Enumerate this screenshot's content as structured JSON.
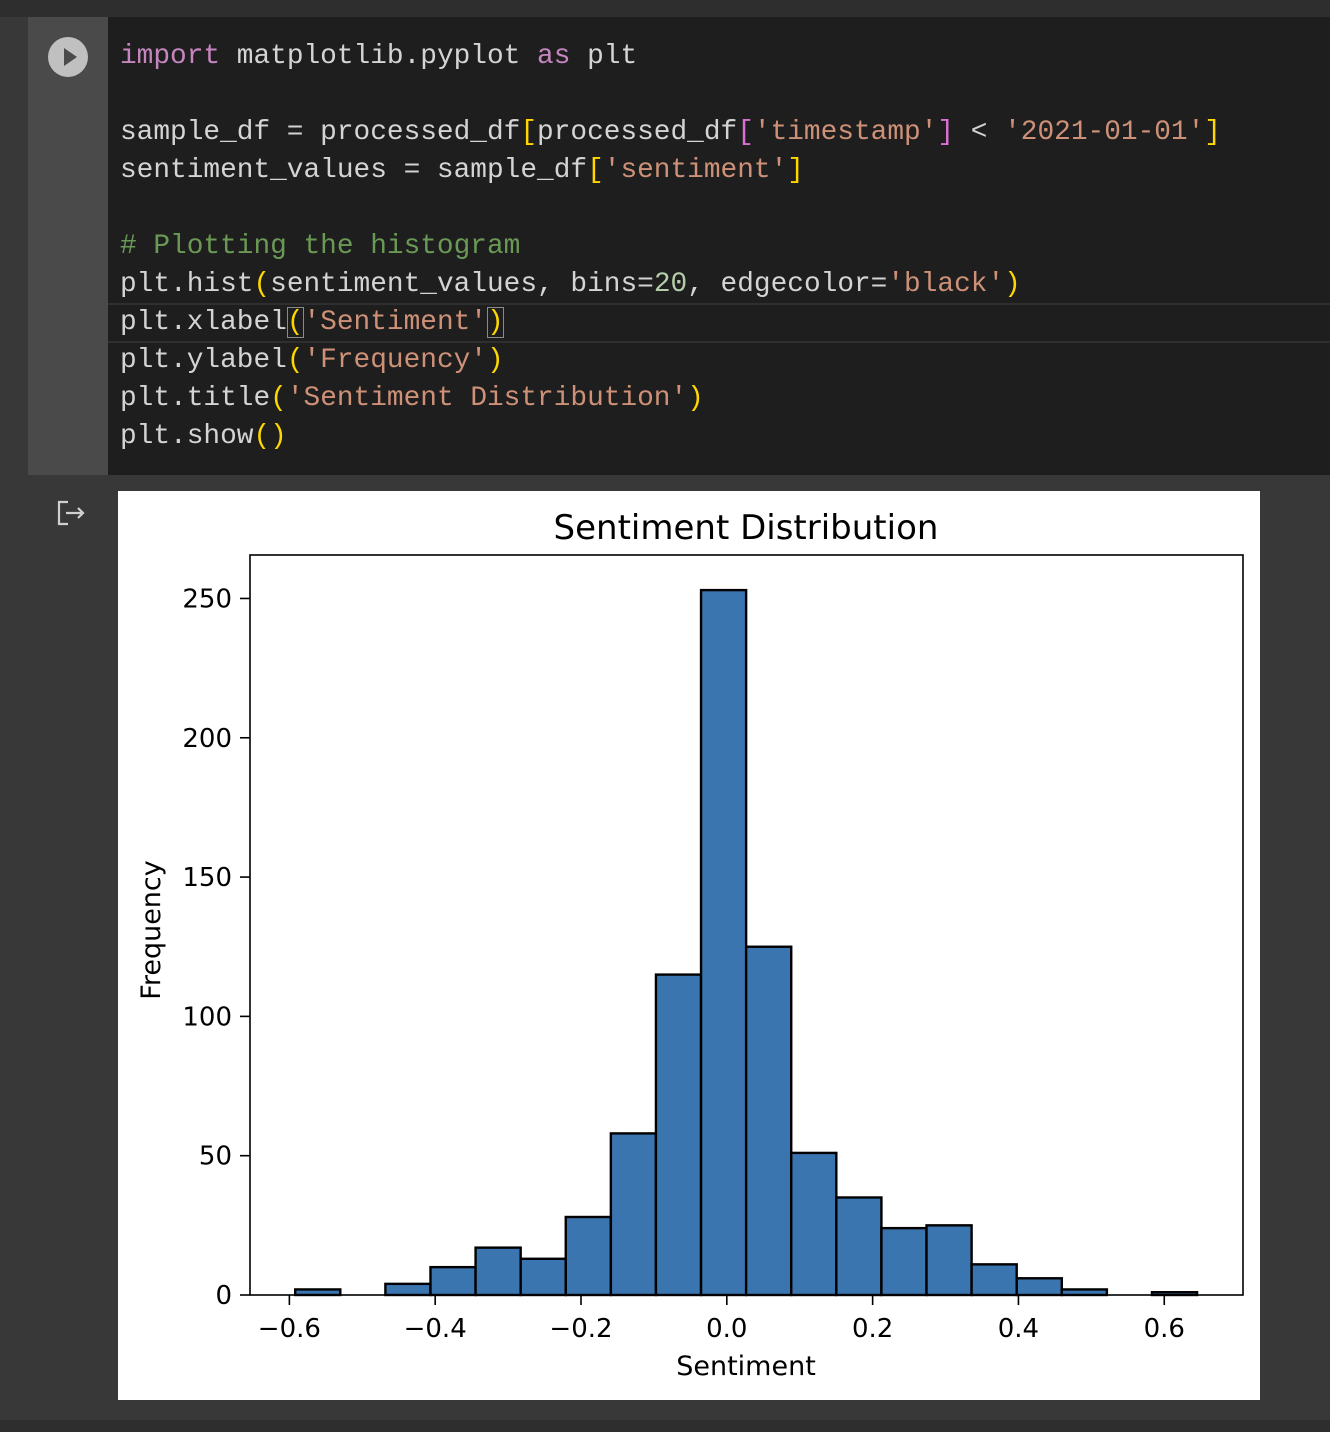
{
  "cell": {
    "run_button": "play-icon",
    "code_lines": [
      [
        {
          "t": "import",
          "c": "kw"
        },
        {
          "t": " matplotlib.pyplot ",
          "c": ""
        },
        {
          "t": "as",
          "c": "kw"
        },
        {
          "t": " plt",
          "c": ""
        }
      ],
      [],
      [
        {
          "t": "sample_df = processed_df",
          "c": ""
        },
        {
          "t": "[",
          "c": "br"
        },
        {
          "t": "processed_df",
          "c": ""
        },
        {
          "t": "[",
          "c": "br2"
        },
        {
          "t": "'timestamp'",
          "c": "str"
        },
        {
          "t": "]",
          "c": "br2"
        },
        {
          "t": " < ",
          "c": ""
        },
        {
          "t": "'2021-01-01'",
          "c": "str"
        },
        {
          "t": "]",
          "c": "br"
        }
      ],
      [
        {
          "t": "sentiment_values = sample_df",
          "c": ""
        },
        {
          "t": "[",
          "c": "br"
        },
        {
          "t": "'sentiment'",
          "c": "str"
        },
        {
          "t": "]",
          "c": "br"
        }
      ],
      [],
      [
        {
          "t": "# Plotting the histogram",
          "c": "com"
        }
      ],
      [
        {
          "t": "plt.hist",
          "c": ""
        },
        {
          "t": "(",
          "c": "br"
        },
        {
          "t": "sentiment_values, bins=",
          "c": ""
        },
        {
          "t": "20",
          "c": "num"
        },
        {
          "t": ", edgecolor=",
          "c": ""
        },
        {
          "t": "'black'",
          "c": "str"
        },
        {
          "t": ")",
          "c": "br"
        }
      ],
      [
        {
          "t": "plt.xlabel",
          "c": ""
        },
        {
          "t": "(",
          "c": "br match"
        },
        {
          "t": "'Sentiment'",
          "c": "str"
        },
        {
          "t": ")",
          "c": "br match"
        }
      ],
      [
        {
          "t": "plt.ylabel",
          "c": ""
        },
        {
          "t": "(",
          "c": "br"
        },
        {
          "t": "'Frequency'",
          "c": "str"
        },
        {
          "t": ")",
          "c": "br"
        }
      ],
      [
        {
          "t": "plt.title",
          "c": ""
        },
        {
          "t": "(",
          "c": "br"
        },
        {
          "t": "'Sentiment Distribution'",
          "c": "str"
        },
        {
          "t": ")",
          "c": "br"
        }
      ],
      [
        {
          "t": "plt.show",
          "c": ""
        },
        {
          "t": "()",
          "c": "br"
        }
      ]
    ]
  },
  "output": {
    "icon": "output-redirect-icon"
  },
  "colors": {
    "bar_fill": "#3b75af",
    "bar_edge": "#000000",
    "keyword": "#c586c0",
    "string": "#ce9178",
    "comment": "#6a9955"
  },
  "chart_data": {
    "type": "bar",
    "subtype": "histogram",
    "title": "Sentiment Distribution",
    "xlabel": "Sentiment",
    "ylabel": "Frequency",
    "bin_range": [
      -0.592,
      0.645
    ],
    "bins": 20,
    "values": [
      2,
      0,
      4,
      10,
      17,
      13,
      28,
      58,
      115,
      253,
      125,
      51,
      35,
      24,
      25,
      11,
      6,
      2,
      0,
      1
    ],
    "xlim": [
      -0.654,
      0.708
    ],
    "ylim": [
      0,
      265.6
    ],
    "xticks": [
      -0.6,
      -0.4,
      -0.2,
      0.0,
      0.2,
      0.4,
      0.6
    ],
    "xtick_labels": [
      "−0.6",
      "−0.4",
      "−0.2",
      "0.0",
      "0.2",
      "0.4",
      "0.6"
    ],
    "yticks": [
      0,
      50,
      100,
      150,
      200,
      250
    ],
    "ytick_labels": [
      "0",
      "50",
      "100",
      "150",
      "200",
      "250"
    ],
    "grid": false,
    "legend": "none"
  }
}
